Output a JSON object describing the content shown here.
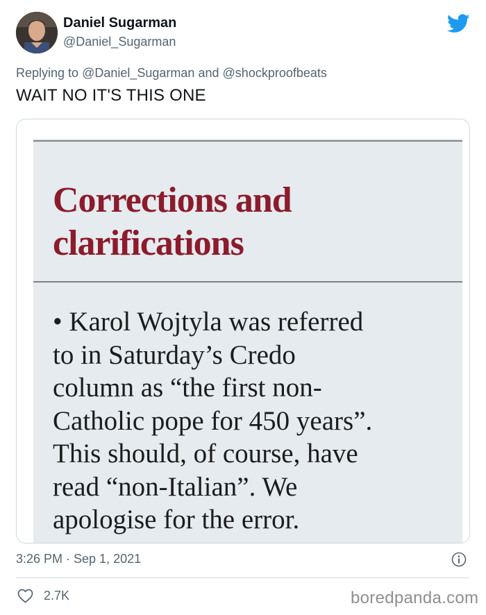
{
  "author": {
    "name": "Daniel Sugarman",
    "handle": "@Daniel_Sugarman"
  },
  "reply": {
    "prefix": "Replying to",
    "mention_1": "@Daniel_Sugarman",
    "conjunction": "and",
    "mention_2": "@shockproofbeats"
  },
  "tweet": {
    "text": "WAIT NO IT'S THIS ONE"
  },
  "clipping": {
    "title_lines": [
      "Corrections and",
      "clarifications"
    ],
    "body_lines": [
      "• Karol Wojtyla was referred",
      "to in Saturday’s Credo",
      "column as “the first non-",
      "Catholic pope for 450 years”.",
      "This should, of course, have",
      "read “non-Italian”. We",
      "apologise for the error."
    ]
  },
  "meta": {
    "timestamp": "3:26 PM · Sep 1, 2021",
    "likes": "2.7K"
  },
  "watermark": "boredpanda.com",
  "colors": {
    "twitter_blue": "#1d9bf0",
    "clip_title": "#8c1b2c",
    "clip_background": "#e5ebef",
    "secondary_text": "#536471"
  },
  "icons": {
    "brand": "twitter-bird-icon",
    "info": "info-icon",
    "like": "heart-icon"
  }
}
